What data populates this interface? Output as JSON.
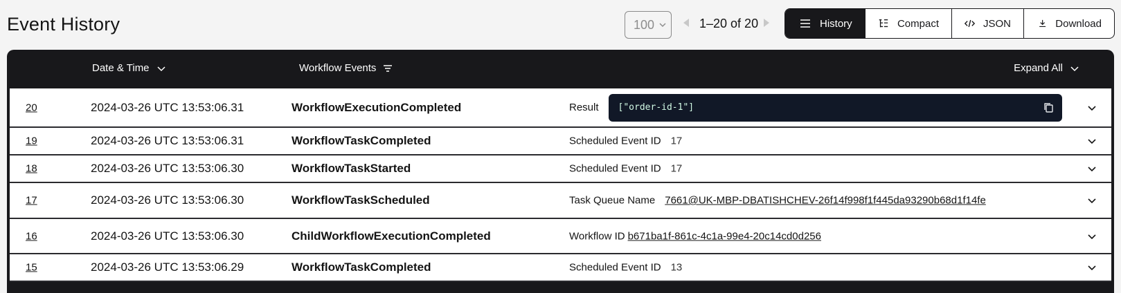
{
  "page": {
    "title": "Event History"
  },
  "pagination": {
    "per_page": "100",
    "range": "1–20 of 20"
  },
  "views": {
    "history": "History",
    "compact": "Compact",
    "json": "JSON",
    "download": "Download"
  },
  "table": {
    "headers": {
      "date": "Date & Time",
      "events": "Workflow Events",
      "expand": "Expand All"
    },
    "rows": [
      {
        "id": "20",
        "date": "2024-03-26 UTC 13:53:06.31",
        "type": "WorkflowExecutionCompleted",
        "label": "Result",
        "value": "[\"order-id-1\"]"
      },
      {
        "id": "19",
        "date": "2024-03-26 UTC 13:53:06.31",
        "type": "WorkflowTaskCompleted",
        "label": "Scheduled Event ID",
        "value": "17"
      },
      {
        "id": "18",
        "date": "2024-03-26 UTC 13:53:06.30",
        "type": "WorkflowTaskStarted",
        "label": "Scheduled Event ID",
        "value": "17"
      },
      {
        "id": "17",
        "date": "2024-03-26 UTC 13:53:06.30",
        "type": "WorkflowTaskScheduled",
        "label": "Task Queue Name",
        "value": "7661@UK-MBP-DBATISHCHEV-26f14f998f1f445da93290b68d1f14fe"
      },
      {
        "id": "16",
        "date": "2024-03-26 UTC 13:53:06.30",
        "type": "ChildWorkflowExecutionCompleted",
        "label": "Workflow ID",
        "value": "b671ba1f-861c-4c1a-99e4-20c14cd0d256"
      },
      {
        "id": "15",
        "date": "2024-03-26 UTC 13:53:06.29",
        "type": "WorkflowTaskCompleted",
        "label": "Scheduled Event ID",
        "value": "13"
      }
    ]
  },
  "colors": {
    "header_bg": "#18181b",
    "code_bg": "#111827",
    "code_text": "#d1fae5"
  },
  "icons": [
    "chevron-down-icon",
    "triangle-left-icon",
    "triangle-right-icon",
    "list-icon",
    "tree-icon",
    "code-icon",
    "download-icon",
    "filter-icon",
    "copy-icon"
  ]
}
